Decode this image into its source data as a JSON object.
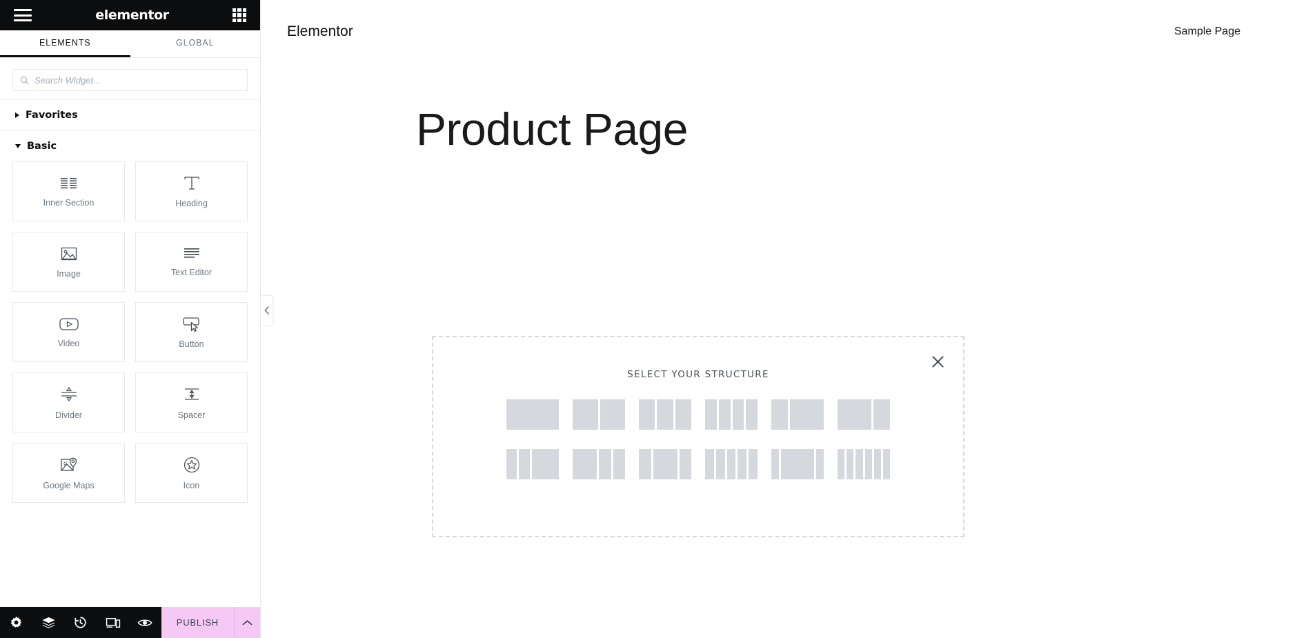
{
  "panel": {
    "brand": "elementor",
    "menu_icon": "hamburger-icon",
    "apps_icon": "apps-grid-icon",
    "tabs": [
      {
        "label": "ELEMENTS",
        "active": true
      },
      {
        "label": "GLOBAL",
        "active": false
      }
    ],
    "search": {
      "placeholder": "Search Widget...",
      "value": "",
      "icon": "search-icon"
    },
    "categories": [
      {
        "label": "Favorites",
        "expanded": false
      },
      {
        "label": "Basic",
        "expanded": true
      }
    ],
    "widgets": [
      {
        "label": "Inner Section",
        "icon": "inner-section-icon"
      },
      {
        "label": "Heading",
        "icon": "heading-t-icon"
      },
      {
        "label": "Image",
        "icon": "image-icon"
      },
      {
        "label": "Text Editor",
        "icon": "text-editor-icon"
      },
      {
        "label": "Video",
        "icon": "video-play-icon"
      },
      {
        "label": "Button",
        "icon": "button-cursor-icon"
      },
      {
        "label": "Divider",
        "icon": "divider-icon"
      },
      {
        "label": "Spacer",
        "icon": "spacer-icon"
      },
      {
        "label": "Google Maps",
        "icon": "google-maps-icon"
      },
      {
        "label": "Icon",
        "icon": "star-circle-icon"
      }
    ],
    "footer": {
      "icons": [
        {
          "name": "settings-gear-icon"
        },
        {
          "name": "navigator-layers-icon"
        },
        {
          "name": "history-clock-icon"
        },
        {
          "name": "responsive-mode-icon"
        },
        {
          "name": "preview-eye-icon"
        }
      ],
      "publish_label": "PUBLISH",
      "publish_caret_icon": "chevron-up-icon",
      "publish_color": "#f5c8f5"
    }
  },
  "canvas": {
    "site_title": "Elementor",
    "nav_link": "Sample Page",
    "page_title": "Product Page",
    "collapse_icon": "chevron-left-icon"
  },
  "structure_dialog": {
    "title": "SELECT YOUR STRUCTURE",
    "close_icon": "close-x-icon",
    "presets": [
      {
        "name": "one-column",
        "columns": [
          100
        ]
      },
      {
        "name": "two-columns",
        "columns": [
          50,
          50
        ]
      },
      {
        "name": "three-columns",
        "columns": [
          33,
          33,
          33
        ]
      },
      {
        "name": "four-columns",
        "columns": [
          25,
          25,
          25,
          25
        ]
      },
      {
        "name": "left-third-right-two-thirds",
        "columns": [
          33,
          66
        ]
      },
      {
        "name": "left-two-thirds-right-third",
        "columns": [
          66,
          33
        ]
      },
      {
        "name": "narrow-narrow-wide",
        "columns": [
          22,
          22,
          56
        ]
      },
      {
        "name": "wide-narrow-narrow",
        "columns": [
          50,
          25,
          25
        ]
      },
      {
        "name": "narrow-wide-narrow",
        "columns": [
          25,
          50,
          25
        ]
      },
      {
        "name": "five-columns",
        "columns": [
          20,
          20,
          20,
          20,
          20
        ]
      },
      {
        "name": "narrow-wide-narrow-alt",
        "columns": [
          16,
          68,
          16
        ]
      },
      {
        "name": "six-columns",
        "columns": [
          16.6,
          16.6,
          16.6,
          16.6,
          16.6,
          16.6
        ]
      }
    ]
  },
  "colors": {
    "panel_header_bg": "#0c0d0e",
    "accent_publish": "#f5c8f5",
    "preset_block": "#d5d8dc",
    "border": "#e6e9ec"
  }
}
